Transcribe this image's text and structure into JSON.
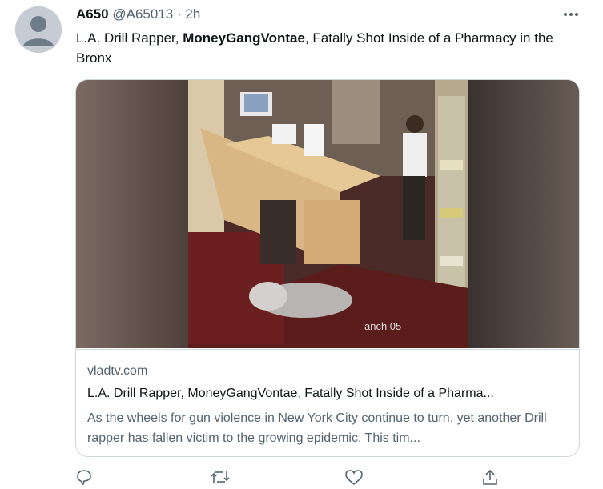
{
  "tweet": {
    "author_name": "A650",
    "author_handle": "@A65013",
    "separator": "·",
    "time": "2h",
    "text_before": "L.A. Drill Rapper, ",
    "text_bold": "MoneyGangVontae",
    "text_after": ", Fatally Shot Inside of a Pharmacy in the Bronx"
  },
  "card": {
    "media_overlay_text": "anch 05",
    "domain": "vladtv.com",
    "title": "L.A. Drill Rapper, MoneyGangVontae, Fatally Shot Inside of a Pharma...",
    "description": "As the wheels for gun violence in New York City continue to turn, yet another Drill rapper has fallen victim to the growing epidemic. This tim..."
  },
  "icons": [
    "avatar-default-icon",
    "more-icon",
    "reply-icon",
    "retweet-icon",
    "like-icon",
    "share-icon"
  ],
  "colors": {
    "text": "#0f1419",
    "secondary": "#536471",
    "border": "#cfd9de"
  }
}
